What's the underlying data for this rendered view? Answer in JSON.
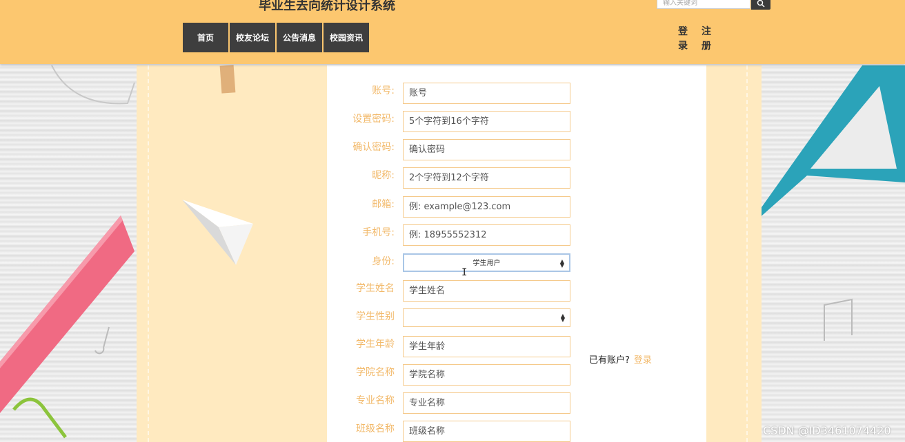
{
  "header": {
    "site_title": "毕业生去向统计设计系统",
    "search_placeholder": "输入关键词",
    "nav": [
      "首页",
      "校友论坛",
      "公告消息",
      "校园资讯"
    ],
    "auth": {
      "login": "登录",
      "register": "注册"
    }
  },
  "form": {
    "fields": [
      {
        "label": "账号:",
        "placeholder": "账号"
      },
      {
        "label": "设置密码:",
        "placeholder": "5个字符到16个字符"
      },
      {
        "label": "确认密码:",
        "placeholder": "确认密码"
      },
      {
        "label": "昵称:",
        "placeholder": "2个字符到12个字符"
      },
      {
        "label": "邮箱:",
        "placeholder": "例: example@123.com"
      },
      {
        "label": "手机号:",
        "placeholder": "例: 18955552312"
      },
      {
        "label": "身份:",
        "value": "学生用户"
      },
      {
        "label": "学生姓名",
        "placeholder": "学生姓名"
      },
      {
        "label": "学生性别",
        "value": ""
      },
      {
        "label": "学生年龄",
        "placeholder": "学生年龄"
      },
      {
        "label": "学院名称",
        "placeholder": "学院名称"
      },
      {
        "label": "专业名称",
        "placeholder": "专业名称"
      },
      {
        "label": "班级名称",
        "placeholder": "班级名称"
      }
    ]
  },
  "have_account": {
    "text": "已有账户?",
    "link": "登录"
  },
  "watermark": "CSDN @ID3461074420",
  "colors": {
    "header_bg": "#fcc76f",
    "nav_bg": "#3e3e3e",
    "label": "#f2b96a",
    "input_border": "#f5c98a"
  }
}
